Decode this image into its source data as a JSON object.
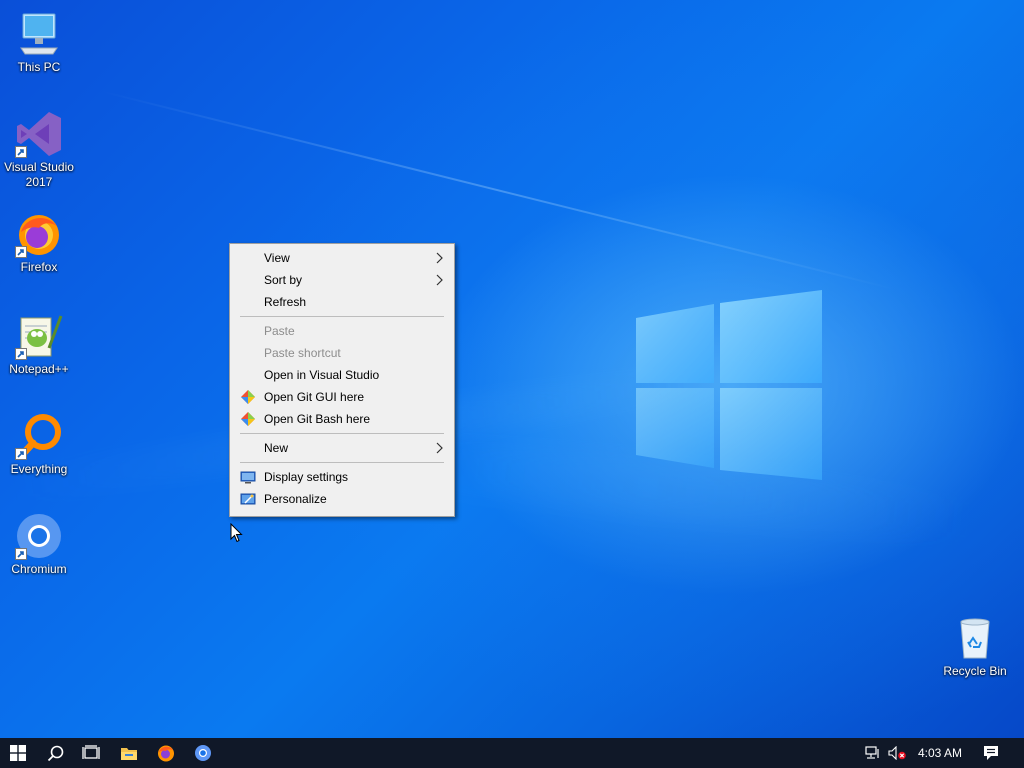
{
  "desktop_icons": [
    {
      "label": "This PC",
      "icon": "this-pc-icon"
    },
    {
      "label": "Visual Studio 2017",
      "icon": "visual-studio-icon"
    },
    {
      "label": "Firefox",
      "icon": "firefox-icon"
    },
    {
      "label": "Notepad++",
      "icon": "notepadpp-icon"
    },
    {
      "label": "Everything",
      "icon": "everything-icon"
    },
    {
      "label": "Chromium",
      "icon": "chromium-icon"
    },
    {
      "label": "Recycle Bin",
      "icon": "recycle-bin-icon"
    }
  ],
  "context_menu": {
    "items": [
      {
        "label": "View",
        "submenu": true,
        "enabled": true
      },
      {
        "label": "Sort by",
        "submenu": true,
        "enabled": true
      },
      {
        "label": "Refresh",
        "enabled": true
      },
      {
        "label": "Paste",
        "enabled": false
      },
      {
        "label": "Paste shortcut",
        "enabled": false
      },
      {
        "label": "Open in Visual Studio",
        "enabled": true
      },
      {
        "label": "Open Git GUI here",
        "enabled": true,
        "icon": "git-icon"
      },
      {
        "label": "Open Git Bash here",
        "enabled": true,
        "icon": "git-icon"
      },
      {
        "label": "New",
        "submenu": true,
        "enabled": true
      },
      {
        "label": "Display settings",
        "enabled": true,
        "icon": "display-settings-icon"
      },
      {
        "label": "Personalize",
        "enabled": true,
        "icon": "personalize-icon"
      }
    ]
  },
  "taskbar": {
    "items": [
      "start-icon",
      "search-icon",
      "task-view-icon",
      "file-explorer-icon",
      "firefox-icon",
      "chromium-icon"
    ],
    "tray": [
      "network-icon",
      "volume-muted-icon",
      "notifications-icon"
    ],
    "clock": "4:03 AM"
  },
  "colors": {
    "desktop_blue": "#0a66e8",
    "taskbar": "#101828",
    "menu_bg": "#f0f0f0"
  }
}
